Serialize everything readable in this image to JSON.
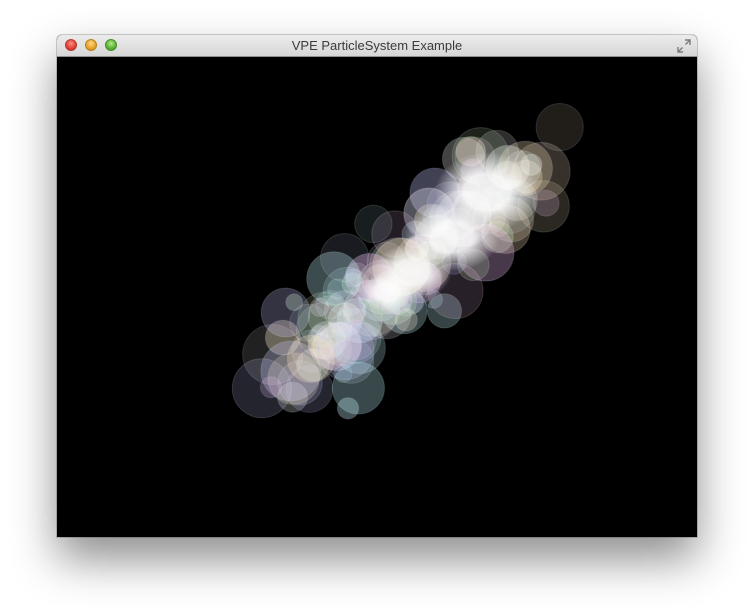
{
  "window": {
    "title": "VPE ParticleSystem Example"
  },
  "titlebar_buttons": [
    "close-icon",
    "minimize-icon",
    "zoom-icon",
    "fullscreen-icon"
  ],
  "colors": {
    "titlebar": "#dcdcdc",
    "canvas_background": "#000000",
    "particle_tints": [
      "#ffffff",
      "#f7c6ff",
      "#c6f7ff",
      "#d6ffc6",
      "#ffe9c6",
      "#c6c6ff"
    ]
  }
}
